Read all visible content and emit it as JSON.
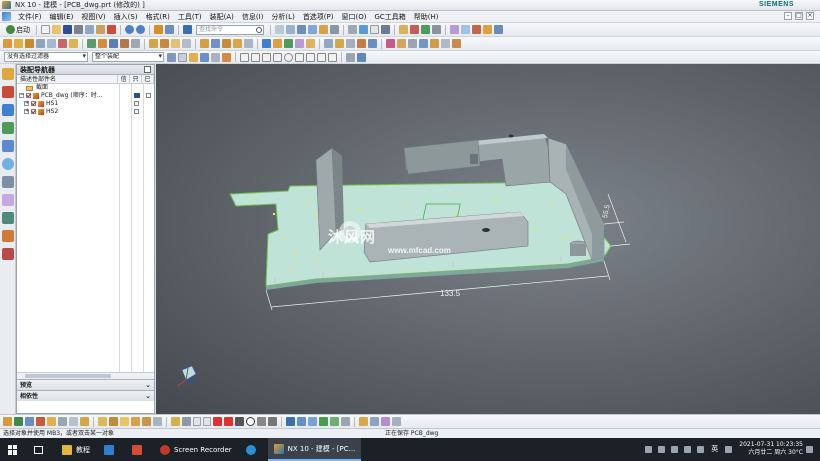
{
  "window": {
    "title": "NX 10 - 建模 - [PCB_dwg.prt  (修改的)  ]",
    "brand": "SIEMENS"
  },
  "menu": {
    "items": [
      "文件(F)",
      "编辑(E)",
      "视图(V)",
      "插入(S)",
      "格式(R)",
      "工具(T)",
      "装配(A)",
      "信息(I)",
      "分析(L)",
      "首选项(P)",
      "窗口(O)",
      "GC工具箱",
      "帮助(H)"
    ]
  },
  "toolbar": {
    "start_label": "启动",
    "search_placeholder": "查找命令"
  },
  "filters": {
    "selection_filter": "没有选择过滤器",
    "assembly_scope": "整个装配"
  },
  "navigator": {
    "title": "装配导航器",
    "columns": {
      "name": "描述性部件名",
      "info": "信",
      "read_only": "只",
      "modified": "已"
    },
    "rows": [
      {
        "label": "截面",
        "type": "folder"
      },
      {
        "label": "PCB_dwg (顺序：时...",
        "type": "assembly"
      },
      {
        "label": "HS1",
        "type": "part"
      },
      {
        "label": "HS2",
        "type": "part"
      }
    ],
    "preview_label": "预览",
    "dependency_label": "相依性"
  },
  "viewport": {
    "watermark_text": "沐风网",
    "watermark_url": "www.mfcad.com",
    "dimension_horizontal": "133.5",
    "dimension_vertical": "55.5"
  },
  "status": {
    "prompt": "选择对象并使用 MB3，或者双击某一对象",
    "message": "正在保存 PCB_dwg"
  },
  "taskbar": {
    "apps": [
      {
        "label": "教程",
        "color": "#e8b53c"
      },
      {
        "label": "",
        "color": "#2d7fd6"
      },
      {
        "label": "",
        "color": "#d64a2d"
      },
      {
        "label": "Screen Recorder",
        "color": "#c0392b"
      },
      {
        "label": "",
        "color": "#2b8fd6"
      },
      {
        "label": "NX 10 - 建模 - [PC...",
        "color": "#3b7fd0"
      }
    ],
    "language": "英",
    "time": "2021-07-31 10:23:35",
    "date": "六月廿二 周六 30°C"
  },
  "colors": {
    "accent": "#0a6d75",
    "board": "#b7ddd0",
    "metal": "#9aa4a6",
    "viewport_bg": "#5d6369"
  }
}
